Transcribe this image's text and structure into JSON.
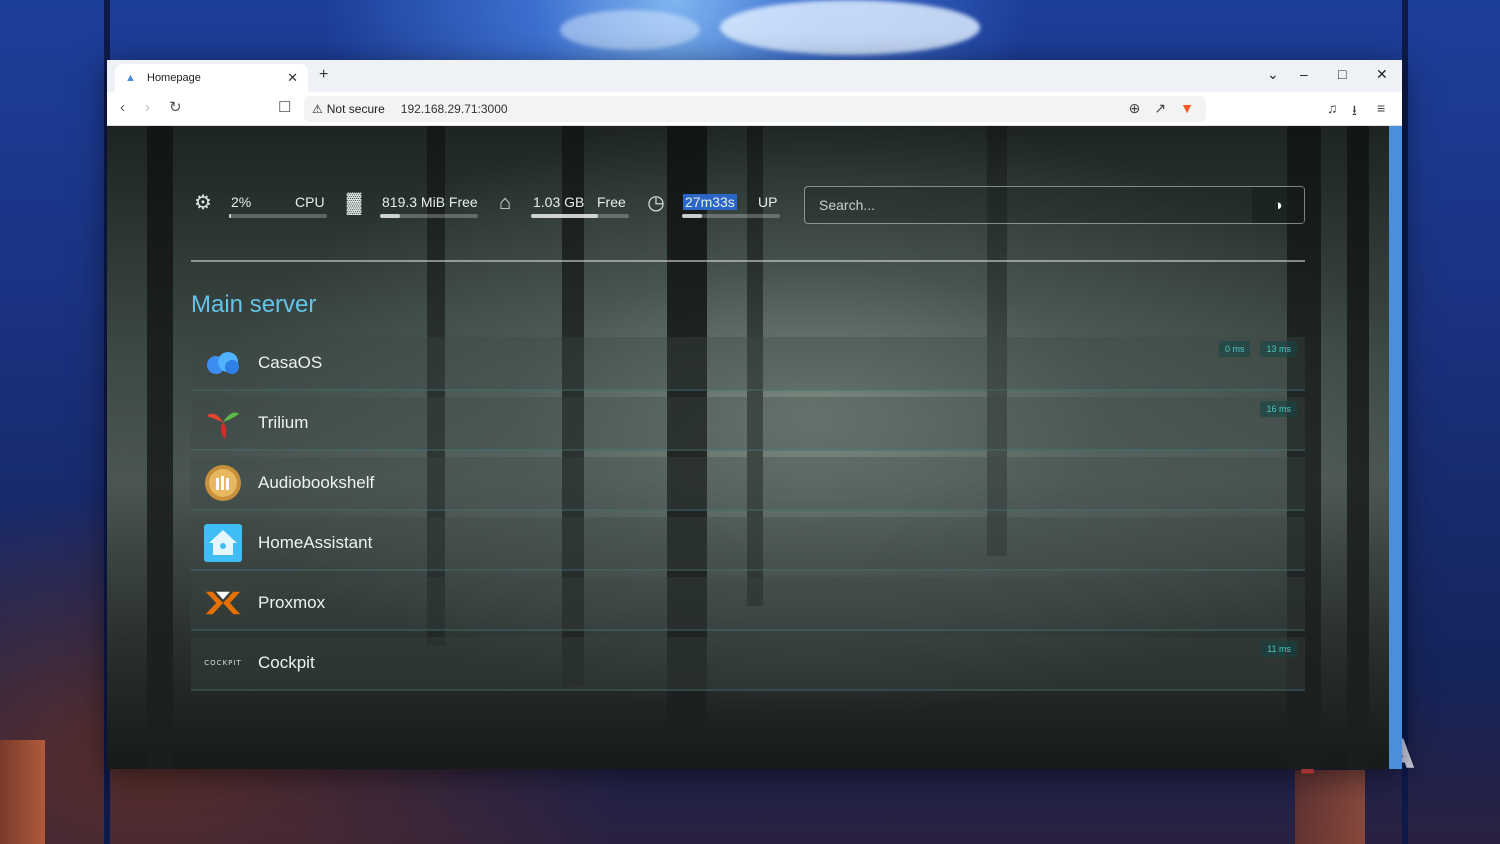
{
  "browser": {
    "tab_title": "Homepage",
    "new_tab": "+",
    "security_label": "Not secure",
    "url": "192.168.29.71:3000"
  },
  "widgets": {
    "cpu": {
      "value": "2%",
      "label": "CPU",
      "level": 0.02
    },
    "memory": {
      "value": "819.3 MiB Free",
      "level": 0.2
    },
    "disk": {
      "value": "1.03 GB",
      "label": "Free",
      "level": 0.68
    },
    "uptime": {
      "value": "27m33s",
      "label": "UP",
      "level": 0.2
    }
  },
  "search": {
    "placeholder": "Search..."
  },
  "group": {
    "title": "Main server",
    "services": [
      {
        "name": "CasaOS",
        "icon": "casaos-icon",
        "pings": [
          "0 ms",
          "13 ms"
        ]
      },
      {
        "name": "Trilium",
        "icon": "trilium-icon",
        "pings": [
          "16 ms"
        ]
      },
      {
        "name": "Audiobookshelf",
        "icon": "audiobookshelf-icon",
        "pings": []
      },
      {
        "name": "HomeAssistant",
        "icon": "homeassistant-icon",
        "pings": []
      },
      {
        "name": "Proxmox",
        "icon": "proxmox-icon",
        "pings": []
      },
      {
        "name": "Cockpit",
        "icon": "cockpit-icon",
        "icon_text": "COCKPIT",
        "pings": [
          "11 ms"
        ]
      }
    ]
  },
  "watermark": {
    "text": "XDA"
  },
  "colors": {
    "accent": "#64c4e8",
    "ping_text": "#4ec5c0",
    "highlight": "#2a66c8"
  }
}
